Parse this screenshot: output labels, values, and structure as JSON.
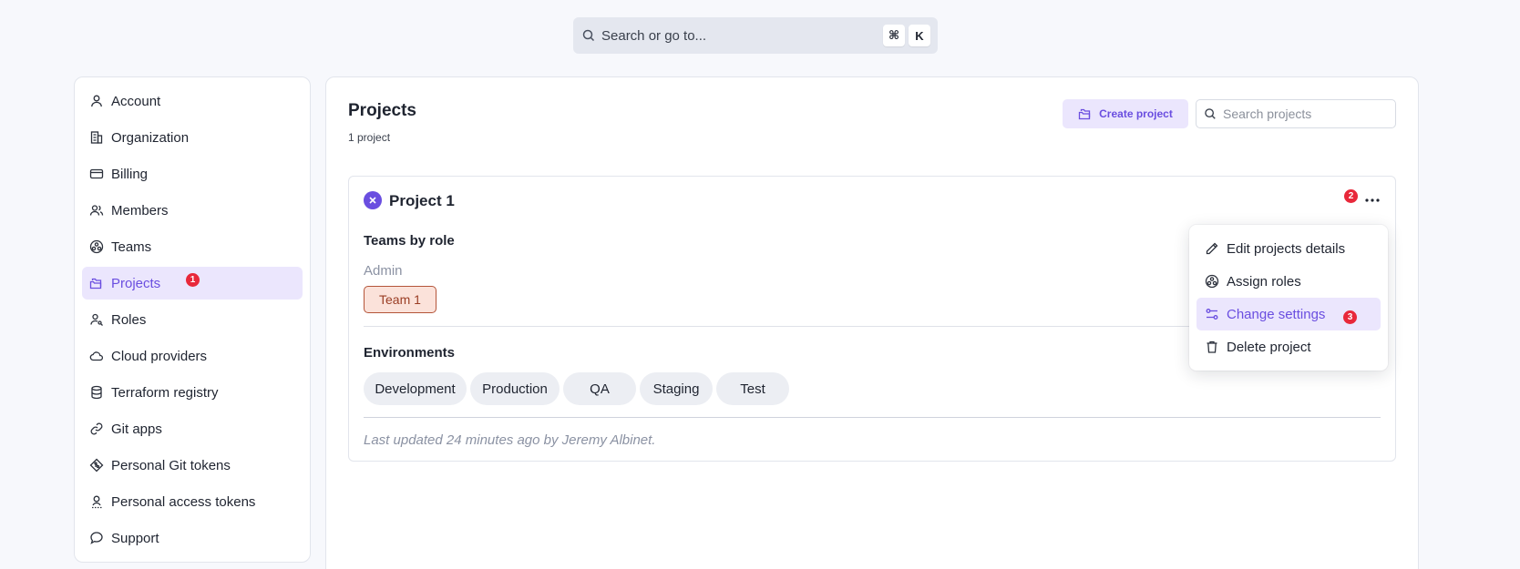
{
  "search": {
    "placeholder": "Search or go to...",
    "shortcut": [
      "⌘",
      "K"
    ]
  },
  "sidebar": {
    "items": [
      {
        "label": "Account",
        "icon": "user-icon"
      },
      {
        "label": "Organization",
        "icon": "building-icon"
      },
      {
        "label": "Billing",
        "icon": "credit-card-icon"
      },
      {
        "label": "Members",
        "icon": "users-icon"
      },
      {
        "label": "Teams",
        "icon": "teams-icon"
      },
      {
        "label": "Projects",
        "icon": "folder-icon",
        "active": true,
        "badge": "1"
      },
      {
        "label": "Roles",
        "icon": "user-key-icon"
      },
      {
        "label": "Cloud providers",
        "icon": "cloud-icon"
      },
      {
        "label": "Terraform registry",
        "icon": "database-icon"
      },
      {
        "label": "Git apps",
        "icon": "link-icon"
      },
      {
        "label": "Personal Git tokens",
        "icon": "git-diamond-icon"
      },
      {
        "label": "Personal access tokens",
        "icon": "key-person-icon"
      },
      {
        "label": "Support",
        "icon": "chat-icon"
      }
    ]
  },
  "main": {
    "title": "Projects",
    "count_text": "1 project",
    "create_label": "Create project",
    "search_placeholder": "Search projects"
  },
  "project": {
    "name": "Project 1",
    "badge": "2",
    "teams_heading": "Teams by role",
    "role": "Admin",
    "team": "Team 1",
    "env_heading": "Environments",
    "environments": [
      "Development",
      "Production",
      "QA",
      "Staging",
      "Test"
    ],
    "updated": "Last updated 24 minutes ago by Jeremy Albinet."
  },
  "menu": {
    "items": [
      {
        "label": "Edit projects details",
        "icon": "pencil-icon"
      },
      {
        "label": "Assign roles",
        "icon": "teams-icon"
      },
      {
        "label": "Change settings",
        "icon": "sliders-icon",
        "highlight": true,
        "badge": "3"
      },
      {
        "label": "Delete project",
        "icon": "trash-icon"
      }
    ]
  },
  "colors": {
    "accent": "#6a4ee0",
    "accent_bg": "#ebe6fd",
    "badge_red": "#e8283a",
    "team_chip_bg": "#fbe2da",
    "team_chip_border": "#b4553a"
  }
}
